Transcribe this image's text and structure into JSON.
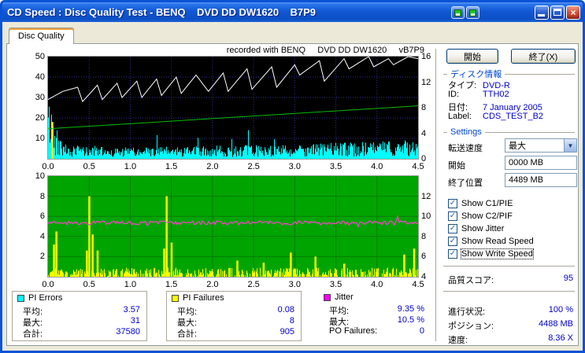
{
  "window": {
    "title": "CD Speed : Disc Quality Test - BENQ    DVD DD DW1620    B7P9"
  },
  "tab": {
    "label": "Disc Quality"
  },
  "charts": {
    "header": "recorded with BENQ     DVD DD DW1620     vB7P9"
  },
  "chart_data": [
    {
      "type": "area+line",
      "name": "quality-speed-chart",
      "seed": 42,
      "x_range": [
        0,
        4.5
      ],
      "x_ticks": [
        "0.0",
        "0.5",
        "1.0",
        "1.5",
        "2.0",
        "2.5",
        "3.0",
        "3.5",
        "4.0",
        "4.5"
      ],
      "left_axis": {
        "range": [
          0,
          50
        ],
        "ticks": [
          "50",
          "40",
          "30",
          "20",
          "10"
        ]
      },
      "right_axis": {
        "range": [
          0,
          16
        ],
        "ticks": [
          "16",
          "12",
          "8",
          "4",
          "0"
        ]
      },
      "grid": true,
      "background": "#000000",
      "series": [
        {
          "name": "C1/PIE errors",
          "type": "noise-bars",
          "color": "#00ffff",
          "axis": "left",
          "avg": 3.57,
          "max": 31,
          "total": 37580,
          "profile": [
            [
              0,
              28
            ],
            [
              0.04,
              22
            ],
            [
              0.09,
              11
            ],
            [
              0.25,
              6
            ],
            [
              0.8,
              5
            ],
            [
              1.5,
              5.5
            ],
            [
              2.2,
              6
            ],
            [
              3.0,
              6.5
            ],
            [
              3.8,
              7.5
            ],
            [
              4.5,
              8.5
            ]
          ]
        },
        {
          "name": "PI failures burst",
          "type": "spikes",
          "color": "#ffff00",
          "axis": "left",
          "spikes": [
            [
              0.05,
              18
            ]
          ]
        },
        {
          "name": "Write Speed",
          "type": "line",
          "color": "#00bf00",
          "axis": "right",
          "points": [
            [
              0,
              4.7
            ],
            [
              4.5,
              8.3
            ]
          ]
        },
        {
          "name": "Read Speed",
          "type": "line",
          "color": "#ffffff",
          "axis": "left",
          "points": [
            [
              0,
              29
            ],
            [
              0.18,
              33
            ],
            [
              0.36,
              35
            ],
            [
              0.42,
              28
            ],
            [
              0.6,
              36
            ],
            [
              0.66,
              29
            ],
            [
              0.84,
              37
            ],
            [
              0.9,
              30
            ],
            [
              1.08,
              38
            ],
            [
              1.14,
              30
            ],
            [
              1.32,
              39
            ],
            [
              1.38,
              31
            ],
            [
              1.56,
              40
            ],
            [
              1.62,
              32
            ],
            [
              1.8,
              41
            ],
            [
              1.95,
              33
            ],
            [
              2.13,
              42
            ],
            [
              2.19,
              33
            ],
            [
              2.42,
              44
            ],
            [
              2.48,
              34
            ],
            [
              2.72,
              45
            ],
            [
              2.78,
              35
            ],
            [
              3.0,
              46
            ],
            [
              3.06,
              41
            ],
            [
              3.3,
              48
            ],
            [
              3.36,
              38
            ],
            [
              3.6,
              49
            ],
            [
              3.66,
              44
            ],
            [
              3.9,
              50
            ],
            [
              3.96,
              45
            ],
            [
              4.14,
              49
            ],
            [
              4.2,
              46
            ],
            [
              4.38,
              50
            ],
            [
              4.5,
              49
            ]
          ]
        }
      ]
    },
    {
      "type": "bars+line",
      "name": "pif-jitter-chart",
      "seed": 1337,
      "x_range": [
        0,
        4.5
      ],
      "x_ticks": [
        "0.0",
        "0.5",
        "1.0",
        "1.5",
        "2.0",
        "2.5",
        "3.0",
        "3.5",
        "4.0",
        "4.5"
      ],
      "left_axis": {
        "range": [
          0,
          10
        ],
        "ticks": [
          "10",
          "8",
          "6",
          "4",
          "2"
        ]
      },
      "right_axis": {
        "range": [
          4,
          14
        ],
        "ticks": [
          "12",
          "10",
          "8",
          "6",
          "4"
        ]
      },
      "grid": true,
      "background": "#00a400",
      "series": [
        {
          "name": "PI Failures",
          "type": "noise-bars",
          "color": "#ffff00",
          "axis": "left",
          "avg": 0.08,
          "max": 8,
          "total": 905,
          "noise_max": 0.9,
          "spikes": [
            [
              0.07,
              3.2
            ],
            [
              0.1,
              4.5
            ],
            [
              0.47,
              2.6
            ],
            [
              0.5,
              8.0
            ],
            [
              0.54,
              4.2
            ],
            [
              0.6,
              2.6
            ],
            [
              1.41,
              2.8
            ],
            [
              1.44,
              8.0
            ],
            [
              1.5,
              3.4
            ],
            [
              2.3,
              1.6
            ],
            [
              2.62,
              1.4
            ],
            [
              2.95,
              2.4
            ],
            [
              3.25,
              2.0
            ],
            [
              3.6,
              1.3
            ],
            [
              4.33,
              2.2
            ],
            [
              4.45,
              2.8
            ]
          ]
        },
        {
          "name": "Jitter",
          "type": "noisy-line",
          "color": "#ff3fd0",
          "axis": "right",
          "baseline": 9.35,
          "avg": "9.35 %",
          "max": "10.5 %"
        }
      ]
    }
  ],
  "stats": {
    "panels": [
      {
        "name": "PI Errors",
        "swatch": "#00ffff",
        "rows": [
          {
            "label": "平均:",
            "value": "3.57"
          },
          {
            "label": "最大:",
            "value": "31"
          },
          {
            "label": "合計:",
            "value": "37580"
          }
        ]
      },
      {
        "name": "PI Failures",
        "swatch": "#ffff00",
        "rows": [
          {
            "label": "平均:",
            "value": "0.08"
          },
          {
            "label": "最大:",
            "value": "8"
          },
          {
            "label": "合計:",
            "value": "905"
          }
        ]
      },
      {
        "name": "Jitter",
        "swatch": "#ff00ff",
        "rows": [
          {
            "label": "平均:",
            "value": "9.35 %"
          },
          {
            "label": "最大:",
            "value": "10.5 %"
          },
          {
            "label": "PO Failures:",
            "value": "0"
          }
        ]
      }
    ]
  },
  "sidebar": {
    "start_button": "開始",
    "exit_button": "終了(X)",
    "disc_info": {
      "header": "ディスク情報",
      "rows": [
        {
          "label": "タイプ:",
          "value": "DVD-R"
        },
        {
          "label": "ID:",
          "value": "TTH02"
        },
        {
          "label": "日付:",
          "value": "7 January 2005"
        },
        {
          "label": "Label:",
          "value": "CDS_TEST_B2"
        }
      ]
    },
    "settings": {
      "header": "Settings",
      "speed_label": "転送速度",
      "speed_value": "最大",
      "start_label": "開始",
      "start_value": "0000 MB",
      "end_label": "終了位置",
      "end_value": "4489 MB",
      "checkboxes": [
        {
          "label": "Show C1/PIE",
          "checked": true
        },
        {
          "label": "Show C2/PIF",
          "checked": true
        },
        {
          "label": "Show Jitter",
          "checked": true
        },
        {
          "label": "Show Read Speed",
          "checked": true
        },
        {
          "label": "Show Write Speed",
          "checked": true,
          "focused": true
        }
      ]
    },
    "score": {
      "label": "品質スコア:",
      "value": "95"
    },
    "progress": {
      "label": "進行状況:",
      "value": "100 %"
    },
    "position": {
      "label": "ポジション:",
      "value": "4488 MB"
    },
    "speed": {
      "label": "速度:",
      "value": "8.36 X"
    }
  },
  "colors": {
    "value_text": "#0000cc",
    "section_header": "#0046d5",
    "checkmark": "#2f5fc4",
    "titlebar": "#1157d4"
  }
}
